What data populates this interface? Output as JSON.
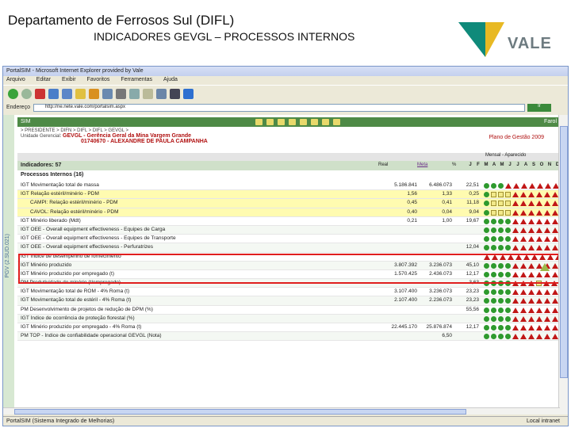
{
  "slide": {
    "title": "Departamento de Ferrosos Sul (DIFL)",
    "subtitle": "INDICADORES GEVGL – PROCESSOS INTERNOS",
    "logo_text": "VALE"
  },
  "browser": {
    "title": "PortalSIM - Microsoft Internet Explorer provided by Vale",
    "menu": [
      "Arquivo",
      "Editar",
      "Exibir",
      "Favoritos",
      "Ferramentas",
      "Ajuda"
    ],
    "address_label": "Endereço",
    "address_value": "http://ne.nete.vale.com/portalsim.aspx",
    "go_label": "Ir",
    "status_left": "PortalSIM (Sistema Integrado de Melhorias)",
    "status_right": "Local intranet"
  },
  "portal": {
    "header": "SIM",
    "header_right": "Farol",
    "side_text": "PGV (2.SUD.021)",
    "info_path": "> PRESIDENTE > DIFN > DIFL > DIFL > GEVGL >",
    "unit_label": "Unidade Gerencial:",
    "unit_code": "GEVGL",
    "unit_name": "- Gerência Geral da Mina Vargem Grande",
    "person": "01740670 - ALEXANDRE DE PAULA CAMPANHA",
    "plan": "Plano de Gestão 2009",
    "mensal": "Mensal - Aparecido",
    "indicators_label": "Indicadores: 57",
    "process_label": "Processos Internos (16)",
    "col_real": "Real",
    "col_meta": "Meta",
    "col_pct": "%",
    "months": [
      "J",
      "F",
      "M",
      "A",
      "M",
      "J",
      "J",
      "A",
      "S",
      "O",
      "N",
      "D"
    ]
  },
  "rows": [
    {
      "label": "IGT Movimentação total de massa",
      "real": "5.186.841",
      "meta": "6.486.073",
      "pct": "22,51",
      "marks": "dddtttttttt",
      "cls": ""
    },
    {
      "label": "IGT Relação estéril/minério - PDM",
      "real": "1,56",
      "meta": "1,33",
      "pct": "0,25",
      "marks": "dsssttttttt",
      "cls": "hl"
    },
    {
      "label": "CAMPI: Relação estéril/minério - PDM",
      "real": "0,45",
      "meta": "0,41",
      "pct": "11,18",
      "marks": "dsssttttttt",
      "cls": "hl sub"
    },
    {
      "label": "CAVOL: Relação estéril/minério - PDM",
      "real": "0,40",
      "meta": "0,04",
      "pct": "9,04",
      "marks": "dsssttttttt",
      "cls": "hl sub"
    },
    {
      "label": "IGT Minério liberado (Mdt)",
      "real": "0,21",
      "meta": "1,00",
      "pct": "19,67",
      "marks": "ddddttttttt",
      "cls": ""
    },
    {
      "label": "IGT OEE - Overall equipment effectiveness - Equipes de Carga",
      "real": "",
      "meta": "",
      "pct": "",
      "marks": "ddddttttttt",
      "cls": "alt"
    },
    {
      "label": "IGT OEE - Overall equipment effectiveness - Equipes de Transporte",
      "real": "",
      "meta": "",
      "pct": "",
      "marks": "ddddttttttt",
      "cls": ""
    },
    {
      "label": "IGT OEE - Overall equipment effectiveness - Perfuratrizes",
      "real": "",
      "meta": "",
      "pct": "12,04",
      "marks": "ddddttttttt",
      "cls": "alt"
    },
    {
      "label": "IGT Índice de desempenho de fornecimento",
      "real": "",
      "meta": "",
      "pct": "",
      "marks": "ttttttttttt",
      "cls": ""
    },
    {
      "label": "IGT Minério produzido",
      "real": "3.807.392",
      "meta": "3.236.073",
      "pct": "45,10",
      "marks": "ddddttttttt",
      "cls": "alt"
    },
    {
      "label": "IGT Minério produzido por empregado (t)",
      "real": "1.570.425",
      "meta": "2.436.073",
      "pct": "12,17",
      "marks": "ddddttttttt",
      "cls": ""
    },
    {
      "label": "PM Produtividade do minério (t/empregado)",
      "real": "",
      "meta": "",
      "pct": "3,63",
      "marks": "ddddtttsttt",
      "cls": "alt"
    },
    {
      "label": "IGT Movimentação total de ROM - 4% Roma (t)",
      "real": "3.107.400",
      "meta": "3.236.073",
      "pct": "23,23",
      "marks": "ddddttttttt",
      "cls": ""
    },
    {
      "label": "IGT Movimentação total de estéril - 4% Roma (t)",
      "real": "2.107.400",
      "meta": "2.236.073",
      "pct": "23,23",
      "marks": "ddddttttttt",
      "cls": "alt"
    },
    {
      "label": "PM Desenvolvimento de projetos de redução de DPM (%)",
      "real": "",
      "meta": "",
      "pct": "55,56",
      "marks": "ddddttttttt",
      "cls": ""
    },
    {
      "label": "IGT Índice de ocorrência de proteção florestal (%)",
      "real": "",
      "meta": "",
      "pct": "",
      "marks": "ddddttttttt",
      "cls": "alt"
    },
    {
      "label": "IGT Minério produzido por empregado - 4% Roma (t)",
      "real": "22.445.170",
      "meta": "25.876.874",
      "pct": "12,17",
      "marks": "ddddttttttt",
      "cls": ""
    },
    {
      "label": "PM TOP - Índice de confiabilidade operacional GEVGL (Nota)",
      "real": "",
      "meta": "6,50",
      "pct": "",
      "marks": "ddddttttttt",
      "cls": "alt"
    }
  ]
}
